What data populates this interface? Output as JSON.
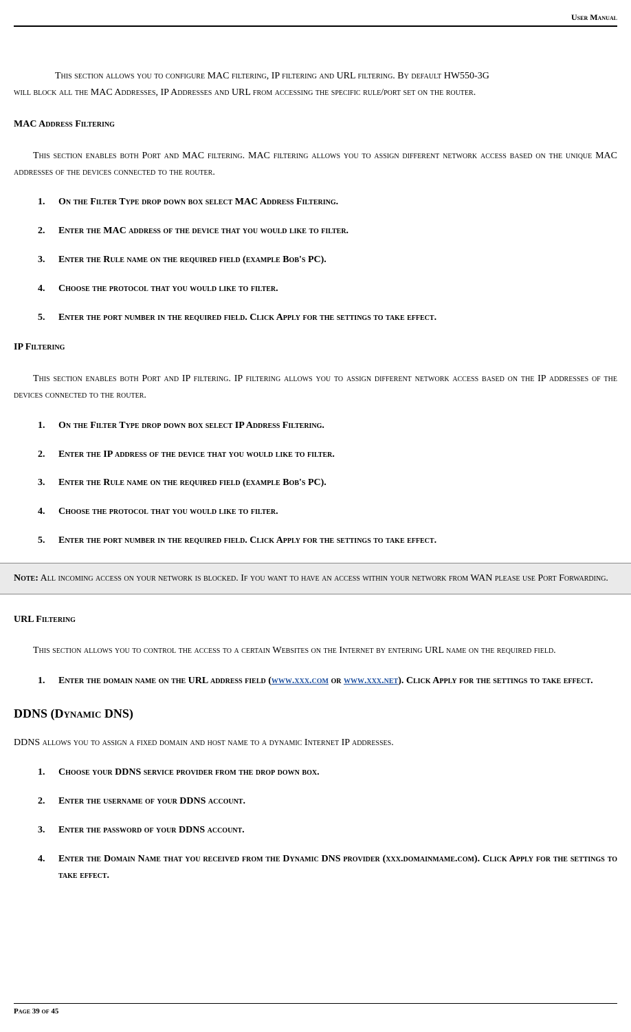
{
  "header": {
    "title": "User Manual"
  },
  "intro": {
    "line1": "This section allows you to configure MAC filtering, IP filtering and URL filtering. By default HW550-3G",
    "line2": "will block all the MAC Addresses, IP Addresses and URL from accessing the specific rule/port set on the router."
  },
  "mac": {
    "title": "MAC Address Filtering",
    "desc": "This section enables both Port and MAC filtering. MAC filtering allows you to assign different network access based on the unique MAC addresses of the devices connected to the router.",
    "items": [
      {
        "num": "1.",
        "text": "On the Filter Type drop down box select MAC Address Filtering."
      },
      {
        "num": "2.",
        "text": "Enter the MAC address of the device that you would like to filter."
      },
      {
        "num": "3.",
        "text": "Enter the Rule name on the required field (example Bob's PC)."
      },
      {
        "num": "4.",
        "text": "Choose the protocol that you would like to filter."
      },
      {
        "num": "5.",
        "text": "Enter the port number in the required field. Click Apply for the settings to take effect."
      }
    ]
  },
  "ip": {
    "title": "IP Filtering",
    "desc": "This section enables both Port and IP filtering. IP filtering allows you to assign different network access based on the IP addresses of the devices connected to the router.",
    "items": [
      {
        "num": "1.",
        "text": "On the Filter Type drop down box select IP Address Filtering."
      },
      {
        "num": "2.",
        "text": "Enter the IP address of the device that you would like to filter."
      },
      {
        "num": "3.",
        "text": "Enter the Rule name on the required field (example Bob's PC)."
      },
      {
        "num": "4.",
        "text": "Choose the protocol that you would like to filter."
      },
      {
        "num": "5.",
        "text": "Enter the port number in the required field. Click Apply for the settings to take effect."
      }
    ]
  },
  "note": {
    "label": "Note:",
    "text": " All incoming access on your network is blocked. If you want to have an access within your network from WAN please use Port Forwarding."
  },
  "url": {
    "title": "URL Filtering",
    "desc": "This section allows you to control the access to a certain Websites on the Internet by entering URL name on the required field.",
    "item1_pre": "Enter the domain name on the URL address field (",
    "item1_link1": "www.xxx.com",
    "item1_mid": " or ",
    "item1_link2": "www.xxx.net",
    "item1_post": "). Click Apply for the settings to take effect.",
    "item1_num": "1."
  },
  "ddns": {
    "title": "DDNS (Dynamic DNS)",
    "desc": "DDNS allows you to assign a fixed domain and host name to a dynamic Internet IP addresses.",
    "items": [
      {
        "num": "1.",
        "text": "Choose your DDNS service provider from the drop down box."
      },
      {
        "num": "2.",
        "text": "Enter the username of your DDNS account."
      },
      {
        "num": "3.",
        "text": "Enter the password of your DDNS account."
      },
      {
        "num": "4.",
        "text": "Enter the Domain Name that you received from the Dynamic DNS provider (xxx.domainmame.com). Click Apply for the settings to take effect."
      }
    ]
  },
  "footer": {
    "page": "Page 39 of 45"
  }
}
